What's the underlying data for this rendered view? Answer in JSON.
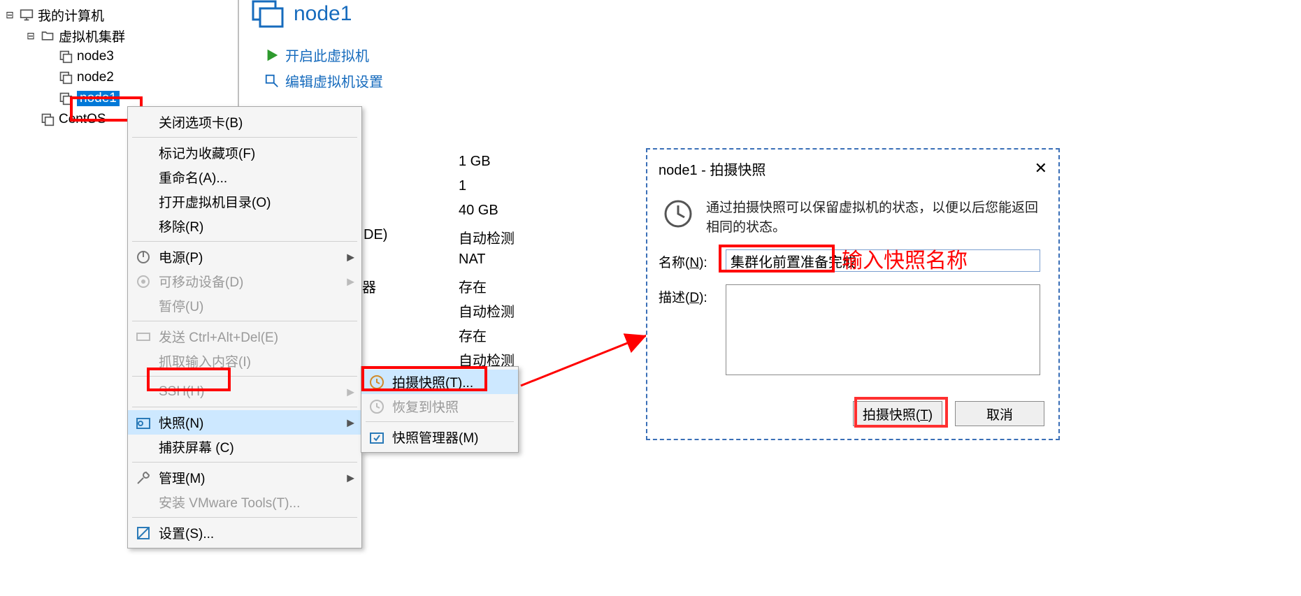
{
  "tree": {
    "root": "我的计算机",
    "cluster": "虚拟机集群",
    "nodes": [
      "node3",
      "node2",
      "node1"
    ],
    "centos": "CentOS"
  },
  "vmpane": {
    "title": "node1",
    "start": "开启此虚拟机",
    "edit": "编辑虚拟机设置"
  },
  "hw": {
    "mem": "1 GB",
    "cpu": "1",
    "disk": "40 GB",
    "auto1": "自动检测",
    "nat": "NAT",
    "present": "存在",
    "auto2": "自动检测",
    "present2": "存在",
    "auto3": "自动检测",
    "de_suffix": "DE)",
    "sound_suffix": "器"
  },
  "ctx": {
    "close_tab": "关闭选项卡(B)",
    "fav": "标记为收藏项(F)",
    "rename": "重命名(A)...",
    "opendir": "打开虚拟机目录(O)",
    "remove": "移除(R)",
    "power": "电源(P)",
    "removable": "可移动设备(D)",
    "pause": "暂停(U)",
    "cad": "发送 Ctrl+Alt+Del(E)",
    "grab": "抓取输入内容(I)",
    "ssh": "SSH(H)",
    "snapshot": "快照(N)",
    "capture": "捕获屏幕 (C)",
    "manage": "管理(M)",
    "tools": "安装 VMware Tools(T)...",
    "settings": "设置(S)..."
  },
  "submenu": {
    "take": "拍摄快照(T)...",
    "revert": "恢复到快照",
    "manager": "快照管理器(M)"
  },
  "dialog": {
    "title": "node1 - 拍摄快照",
    "info": "通过拍摄快照可以保留虚拟机的状态，以便以后您能返回相同的状态。",
    "name_label_pre": "名称(",
    "name_label_u": "N",
    "name_label_post": "):",
    "name_value": "集群化前置准备完成",
    "desc_label_pre": "描述(",
    "desc_label_u": "D",
    "desc_label_post": "):",
    "desc_value": "",
    "btn_take_pre": "拍摄快照(",
    "btn_take_u": "T",
    "btn_take_post": ")",
    "btn_cancel": "取消"
  },
  "annotation": "输入快照名称"
}
